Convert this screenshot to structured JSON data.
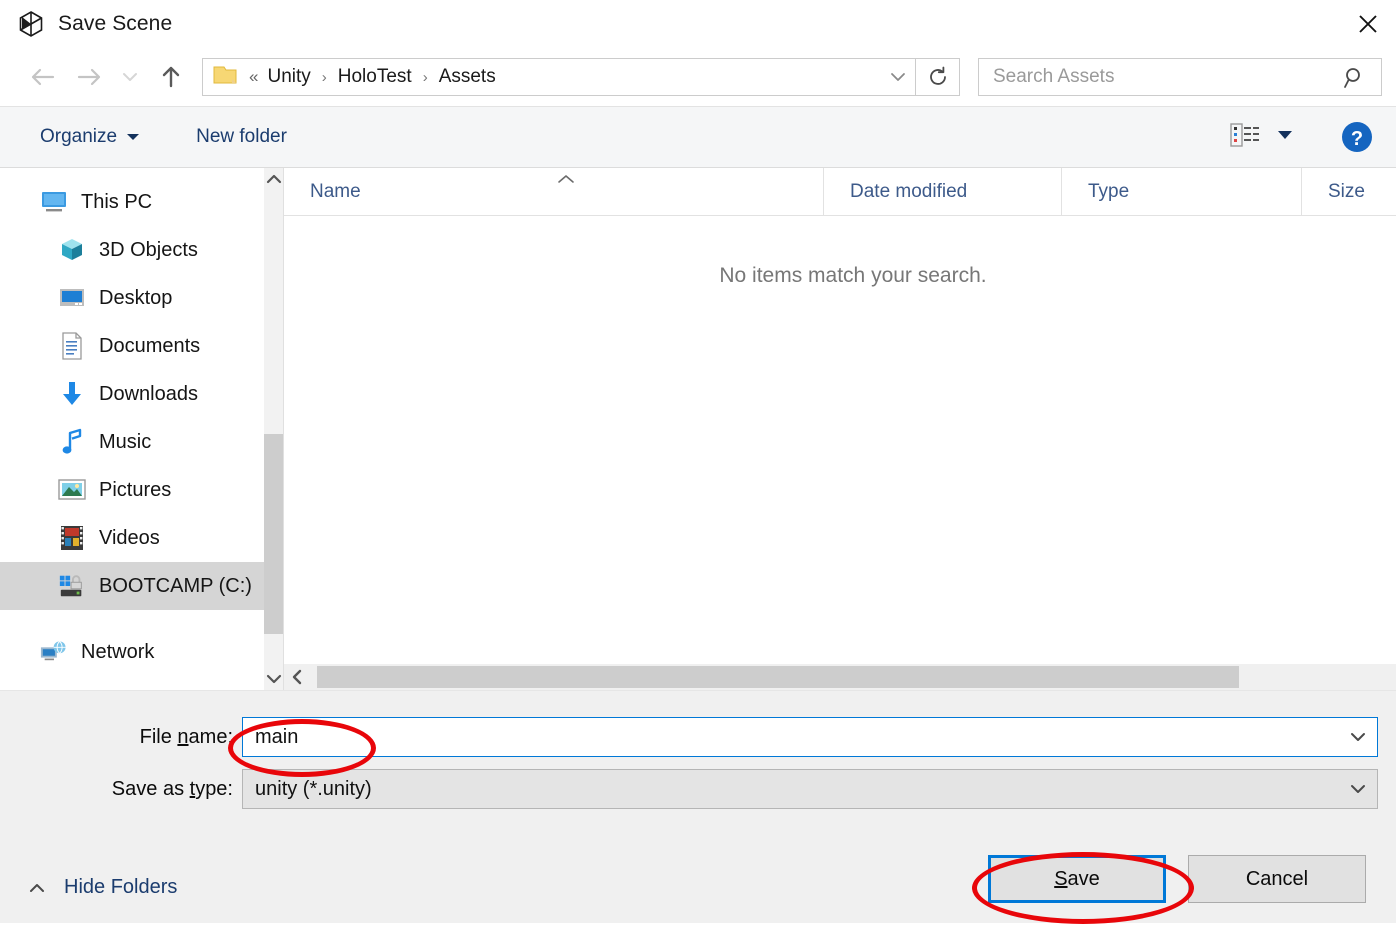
{
  "window": {
    "title": "Save Scene",
    "app_icon": "unity-logo-icon",
    "close_label": "✕"
  },
  "nav": {
    "back_icon": "back-arrow-icon",
    "forward_icon": "forward-arrow-icon",
    "recent_icon": "chevron-down-icon",
    "up_icon": "up-arrow-icon",
    "refresh_icon": "refresh-icon",
    "folder_icon": "folder-icon",
    "breadcrumb_lead": "«",
    "breadcrumbs": [
      "Unity",
      "HoloTest",
      "Assets"
    ],
    "breadcrumb_separator": "›",
    "address_dropdown_icon": "chevron-down-icon"
  },
  "search": {
    "placeholder": "Search Assets",
    "value": "",
    "icon": "search-icon"
  },
  "commandbar": {
    "organize_label": "Organize",
    "organize_caret_icon": "caret-down-icon",
    "new_folder_label": "New folder",
    "view_icon": "list-view-icon",
    "view_caret_icon": "caret-down-icon",
    "help_icon": "help-question-icon",
    "help_label": "?"
  },
  "sidebar": {
    "items": [
      {
        "label": "This PC",
        "icon": "monitor-icon",
        "level": "root",
        "selected": false
      },
      {
        "label": "3D Objects",
        "icon": "cube-icon",
        "level": "child",
        "selected": false
      },
      {
        "label": "Desktop",
        "icon": "desktop-icon",
        "level": "child",
        "selected": false
      },
      {
        "label": "Documents",
        "icon": "document-icon",
        "level": "child",
        "selected": false
      },
      {
        "label": "Downloads",
        "icon": "download-icon",
        "level": "child",
        "selected": false
      },
      {
        "label": "Music",
        "icon": "music-note-icon",
        "level": "child",
        "selected": false
      },
      {
        "label": "Pictures",
        "icon": "picture-icon",
        "level": "child",
        "selected": false
      },
      {
        "label": "Videos",
        "icon": "video-film-icon",
        "level": "child",
        "selected": false
      },
      {
        "label": "BOOTCAMP (C:)",
        "icon": "hard-drive-icon",
        "level": "child",
        "selected": true
      },
      {
        "label": "Network",
        "icon": "network-icon",
        "level": "root",
        "selected": false
      }
    ],
    "scroll_up_icon": "chevron-up-icon",
    "scroll_down_icon": "chevron-down-icon"
  },
  "filelist": {
    "columns": [
      {
        "key": "name",
        "label": "Name"
      },
      {
        "key": "date",
        "label": "Date modified"
      },
      {
        "key": "type",
        "label": "Type"
      },
      {
        "key": "size",
        "label": "Size"
      }
    ],
    "sort_indicator_icon": "sort-ascending-icon",
    "rows": [],
    "empty_message": "No items match your search.",
    "hscroll_left_icon": "chevron-left-icon",
    "hscroll_right_icon": "chevron-right-icon"
  },
  "form": {
    "filename_label_pre": "File ",
    "filename_label_accel": "n",
    "filename_label_post": "ame:",
    "filename_value": "main",
    "filetype_label_pre": "Save as ",
    "filetype_label_accel": "t",
    "filetype_label_post": "ype:",
    "filetype_value": "unity (*.unity)",
    "dropdown_icon": "chevron-down-icon"
  },
  "footer": {
    "hide_folders_label": "Hide Folders",
    "hide_folders_icon": "chevron-up-icon",
    "save_label_accel": "S",
    "save_label_rest": "ave",
    "cancel_label": "Cancel"
  },
  "annotations": {
    "accent_color": "#e8060a",
    "focus_color": "#0078d7",
    "marks": [
      "filename-field-highlight",
      "save-button-highlight"
    ]
  }
}
